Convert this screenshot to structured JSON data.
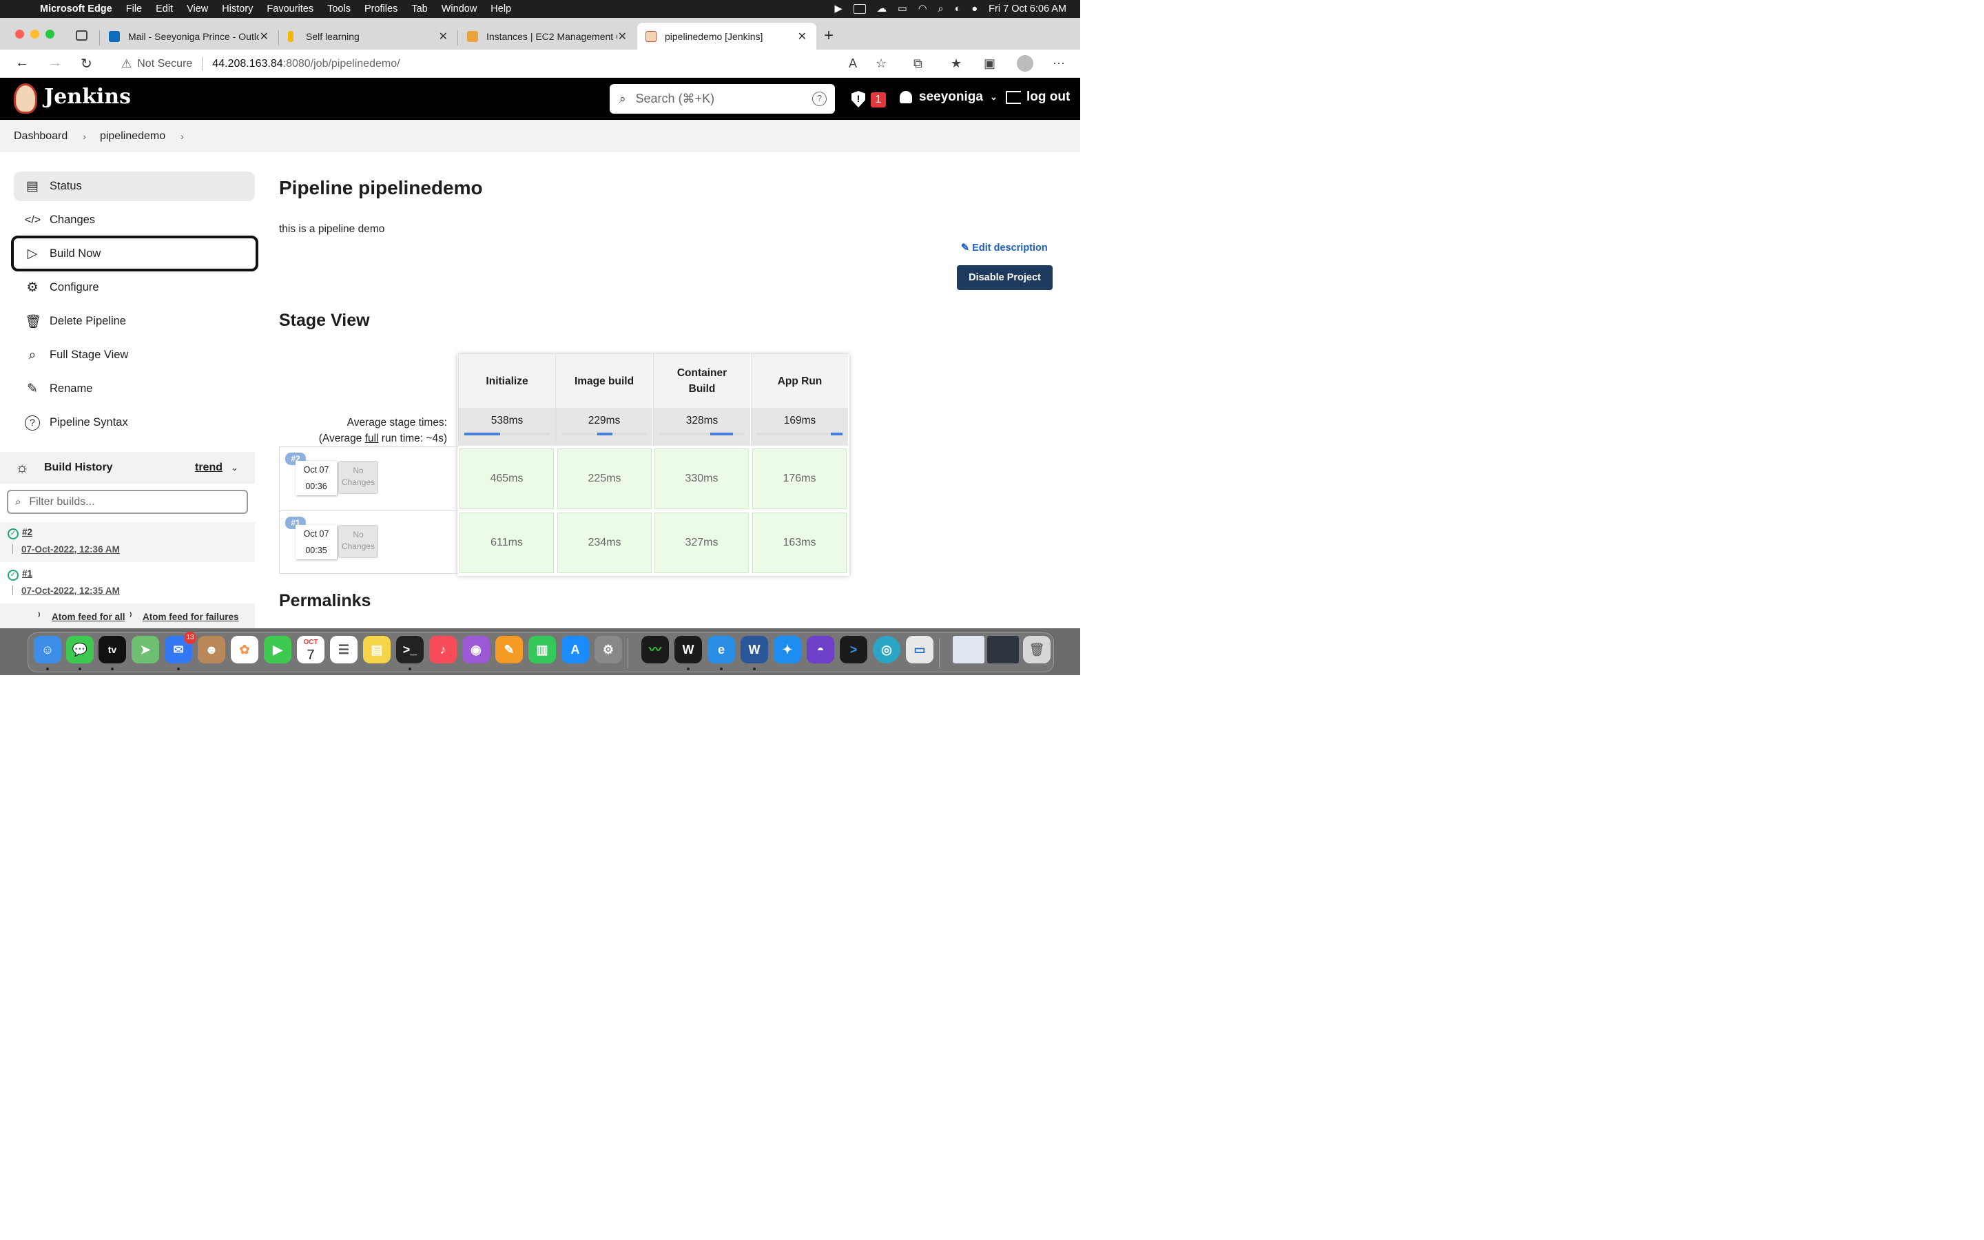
{
  "menubar": {
    "app_name": "Microsoft Edge",
    "items": [
      "File",
      "Edit",
      "View",
      "History",
      "Favourites",
      "Tools",
      "Profiles",
      "Tab",
      "Window",
      "Help"
    ],
    "clock": "Fri 7 Oct  6:06 AM"
  },
  "tabs": [
    {
      "title": "Mail - Seeyoniga Prince - Outlo",
      "icon": "outlook-icon",
      "color": "#0f6cbd"
    },
    {
      "title": "Self learning",
      "icon": "notion-icon",
      "color": "#f2b705"
    },
    {
      "title": "Instances | EC2 Management C",
      "icon": "aws-icon",
      "color": "#e8a33d"
    },
    {
      "title": "pipelinedemo [Jenkins]",
      "icon": "jenkins-icon",
      "color": "#d24939"
    }
  ],
  "address": {
    "security": "Not Secure",
    "host": "44.208.163.84",
    "path": ":8080/job/pipelinedemo/"
  },
  "jenkins": {
    "brand": "Jenkins",
    "search_placeholder": "Search (⌘+K)",
    "security_count": "1",
    "user": "seeyoniga",
    "logout": "log out"
  },
  "breadcrumb": [
    "Dashboard",
    "pipelinedemo"
  ],
  "sidebar": {
    "items": [
      {
        "label": "Status",
        "icon": "status-icon"
      },
      {
        "label": "Changes",
        "icon": "code-icon"
      },
      {
        "label": "Build Now",
        "icon": "play-icon"
      },
      {
        "label": "Configure",
        "icon": "gear-icon"
      },
      {
        "label": "Delete Pipeline",
        "icon": "trash-icon"
      },
      {
        "label": "Full Stage View",
        "icon": "search-icon"
      },
      {
        "label": "Rename",
        "icon": "pencil-icon"
      },
      {
        "label": "Pipeline Syntax",
        "icon": "question-icon"
      }
    ],
    "build_history": {
      "title": "Build History",
      "trend": "trend",
      "filter_placeholder": "Filter builds...",
      "builds": [
        {
          "number": "#2",
          "date": "07-Oct-2022, 12:36 AM"
        },
        {
          "number": "#1",
          "date": "07-Oct-2022, 12:35 AM"
        }
      ],
      "feed_all": "Atom feed for all",
      "feed_failures": "Atom feed for failures"
    }
  },
  "main": {
    "title": "Pipeline pipelinedemo",
    "description": "this is a pipeline demo",
    "edit_description": "Edit description",
    "disable_button": "Disable Project",
    "stage_view_title": "Stage View",
    "avg_label_1": "Average stage times:",
    "avg_label_2_pre": "(Average ",
    "avg_label_2_link": "full",
    "avg_label_2_post": " run time: ~4s)",
    "permalinks": "Permalinks"
  },
  "stage_view": {
    "stages": [
      "Initialize",
      "Image build",
      "Container Build",
      "App Run"
    ],
    "averages": [
      "538ms",
      "229ms",
      "328ms",
      "169ms"
    ],
    "average_share": [
      0.42,
      0.18,
      0.26,
      0.14
    ],
    "runs": [
      {
        "badge": "#2",
        "date": "Oct 07",
        "time": "00:36",
        "changes": "No Changes",
        "durations": [
          "465ms",
          "225ms",
          "330ms",
          "176ms"
        ]
      },
      {
        "badge": "#1",
        "date": "Oct 07",
        "time": "00:35",
        "changes": "No Changes",
        "durations": [
          "611ms",
          "234ms",
          "327ms",
          "163ms"
        ]
      }
    ]
  },
  "dock": {
    "mail_badge": "13",
    "calendar_month": "OCT",
    "calendar_day": "7"
  }
}
